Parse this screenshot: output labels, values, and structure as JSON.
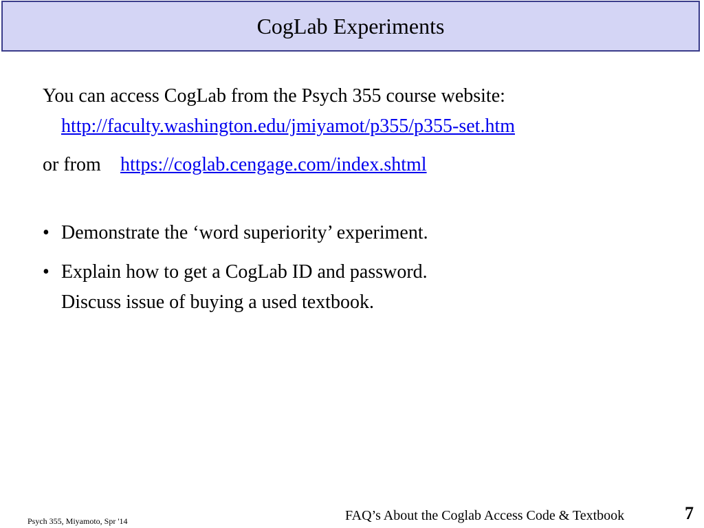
{
  "slide": {
    "title": "CogLab Experiments",
    "access_text": "You can access CogLab from the Psych 355 course website:",
    "course_link": "http://faculty.washington.edu/jmiyamot/p355/p355-set.htm",
    "or_from": "or from",
    "cengage_link": "https://coglab.cengage.com/index.shtml",
    "bullet_glyph": "•",
    "bullets": [
      "Demonstrate the ‘word superiority’ experiment.",
      "Explain how to get a CogLab ID and password."
    ],
    "bullet2_continuation": "Discuss issue of buying a used textbook."
  },
  "footer": {
    "left": "Psych 355, Miyamoto, Spr '14",
    "right": "FAQ’s About the Coglab Access Code & Textbook",
    "page_number": "7"
  }
}
